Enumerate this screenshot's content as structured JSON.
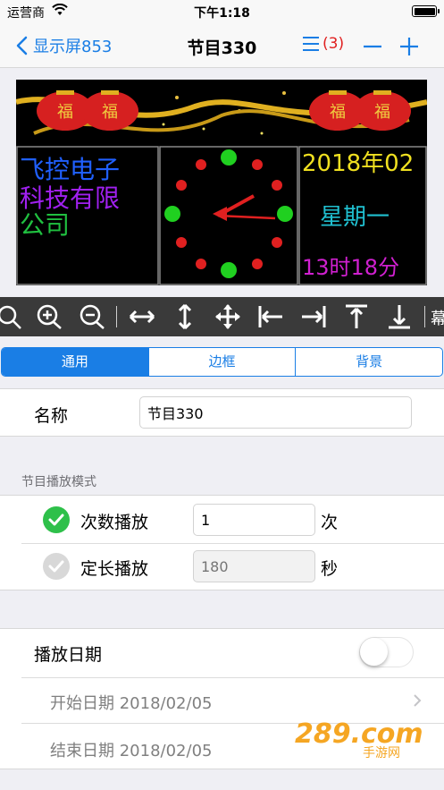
{
  "status_bar": {
    "carrier": "运营商",
    "time": "下午1:18"
  },
  "nav": {
    "back_label": "显示屏853",
    "title": "节目330",
    "count": "(3)"
  },
  "preview": {
    "text_lines": [
      "飞控电子",
      "科技有限",
      "公司"
    ],
    "date": "2018年02",
    "weekday": "星期一",
    "time": "13时18分"
  },
  "toolbar": {
    "more_label": "幕"
  },
  "tabs": [
    {
      "label": "通用",
      "active": true
    },
    {
      "label": "边框",
      "active": false
    },
    {
      "label": "背景",
      "active": false
    }
  ],
  "name_row": {
    "label": "名称",
    "value": "节目330"
  },
  "play_mode": {
    "header": "节目播放模式",
    "count_mode": {
      "label": "次数播放",
      "value": "1",
      "unit": "次",
      "checked": true
    },
    "duration_mode": {
      "label": "定长播放",
      "placeholder": "180",
      "unit": "秒",
      "checked": false
    }
  },
  "play_date": {
    "label": "播放日期",
    "enabled": false,
    "start": "开始日期  2018/02/05",
    "end": "结束日期  2018/02/05"
  },
  "watermark": {
    "text": "289.com",
    "subtext": "手游网"
  },
  "colors": {
    "accent": "#1a7ee5",
    "green": "#2ec04a",
    "red": "#e02020"
  }
}
